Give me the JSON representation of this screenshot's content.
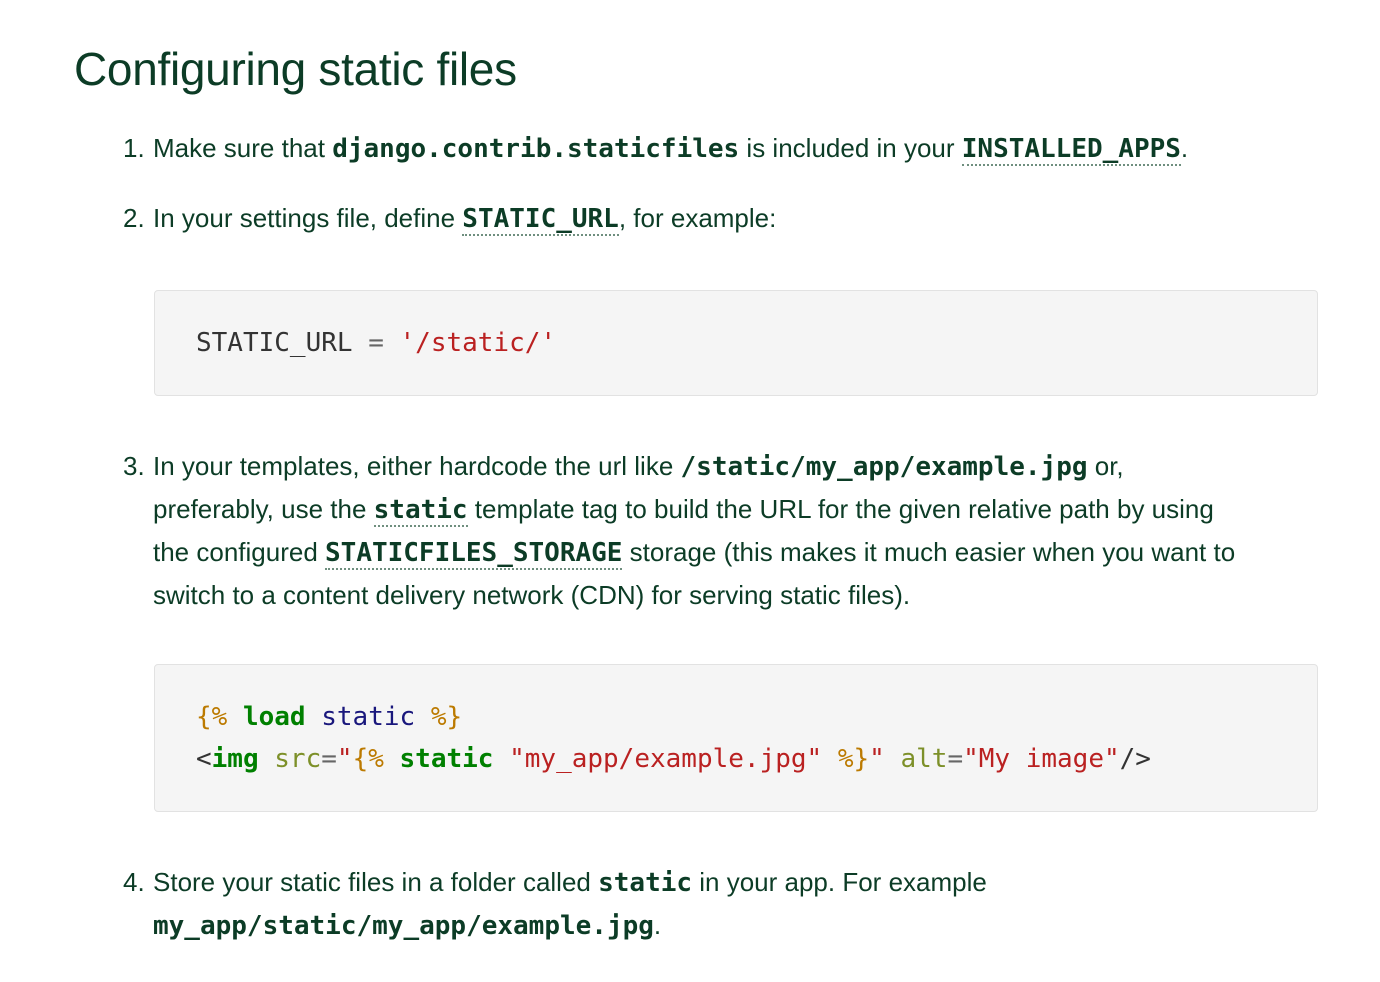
{
  "heading": "Configuring static files",
  "steps": [
    {
      "num": "1.",
      "t1": "Make sure that ",
      "c1": "django.contrib.staticfiles",
      "t2": " is included in your ",
      "link1": "INSTALLED_APPS",
      "t3": "."
    },
    {
      "num": "2.",
      "t1": "In your settings file, define ",
      "link1": "STATIC_URL",
      "t2": ", for example:"
    },
    {
      "num": "3.",
      "t1": "In your templates, either hardcode the url like ",
      "c1": "/static/my_app/example.jpg",
      "t2": " or,",
      "t3": "preferably, use the ",
      "link1": "static",
      "t4": " template tag to build the URL for the given relative path by using",
      "t5": "the configured ",
      "link2": "STATICFILES_STORAGE",
      "t6": " storage (this makes it much easier when you want to",
      "t7": "switch to a content delivery network (CDN) for serving static files)."
    },
    {
      "num": "4.",
      "t1": "Store your static files in a folder called ",
      "c1": "static",
      "t2": " in your app. For example",
      "c2": "my_app/static/my_app/example.jpg",
      "t3": "."
    }
  ],
  "code_blocks": {
    "settings": {
      "name": "STATIC_URL",
      "op": "=",
      "value": "'/static/'"
    },
    "template": {
      "line1": {
        "open": "{%",
        "keyword": "load",
        "name": "static",
        "close": "%}"
      },
      "line2": {
        "lt": "<",
        "tag": "img",
        "attr_src": "src",
        "eq1": "=",
        "q1": "\"",
        "open": "{%",
        "keyword": "static",
        "path": "\"my_app/example.jpg\"",
        "close": "%}",
        "q2": "\"",
        "attr_alt": "alt",
        "eq2": "=",
        "alt_value": "\"My image\"",
        "end": "/>"
      }
    }
  }
}
